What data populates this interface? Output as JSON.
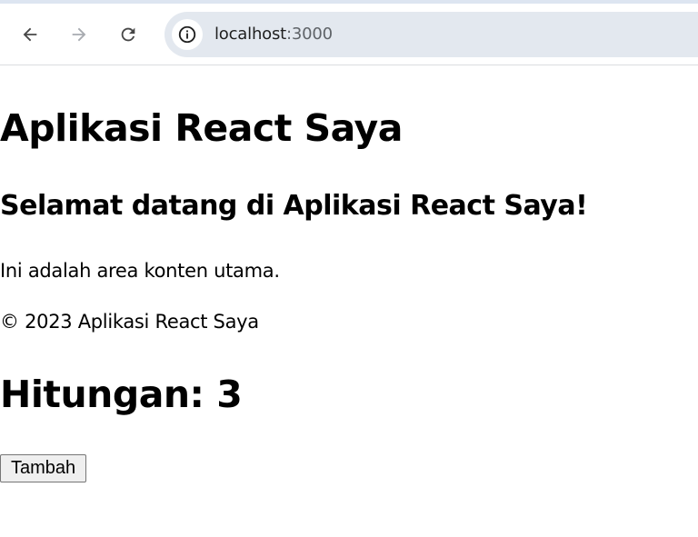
{
  "browser": {
    "url_host": "localhost",
    "url_port": ":3000",
    "icons": {
      "back": "arrow-left-icon",
      "forward": "arrow-right-icon",
      "reload": "reload-icon",
      "site_info": "info-icon"
    }
  },
  "app": {
    "title": "Aplikasi React Saya",
    "welcome": "Selamat datang di Aplikasi React Saya!",
    "main_text": "Ini adalah area konten utama.",
    "footer": "© 2023 Aplikasi React Saya",
    "counter_label": "Hitungan: 3",
    "increment_label": "Tambah"
  }
}
